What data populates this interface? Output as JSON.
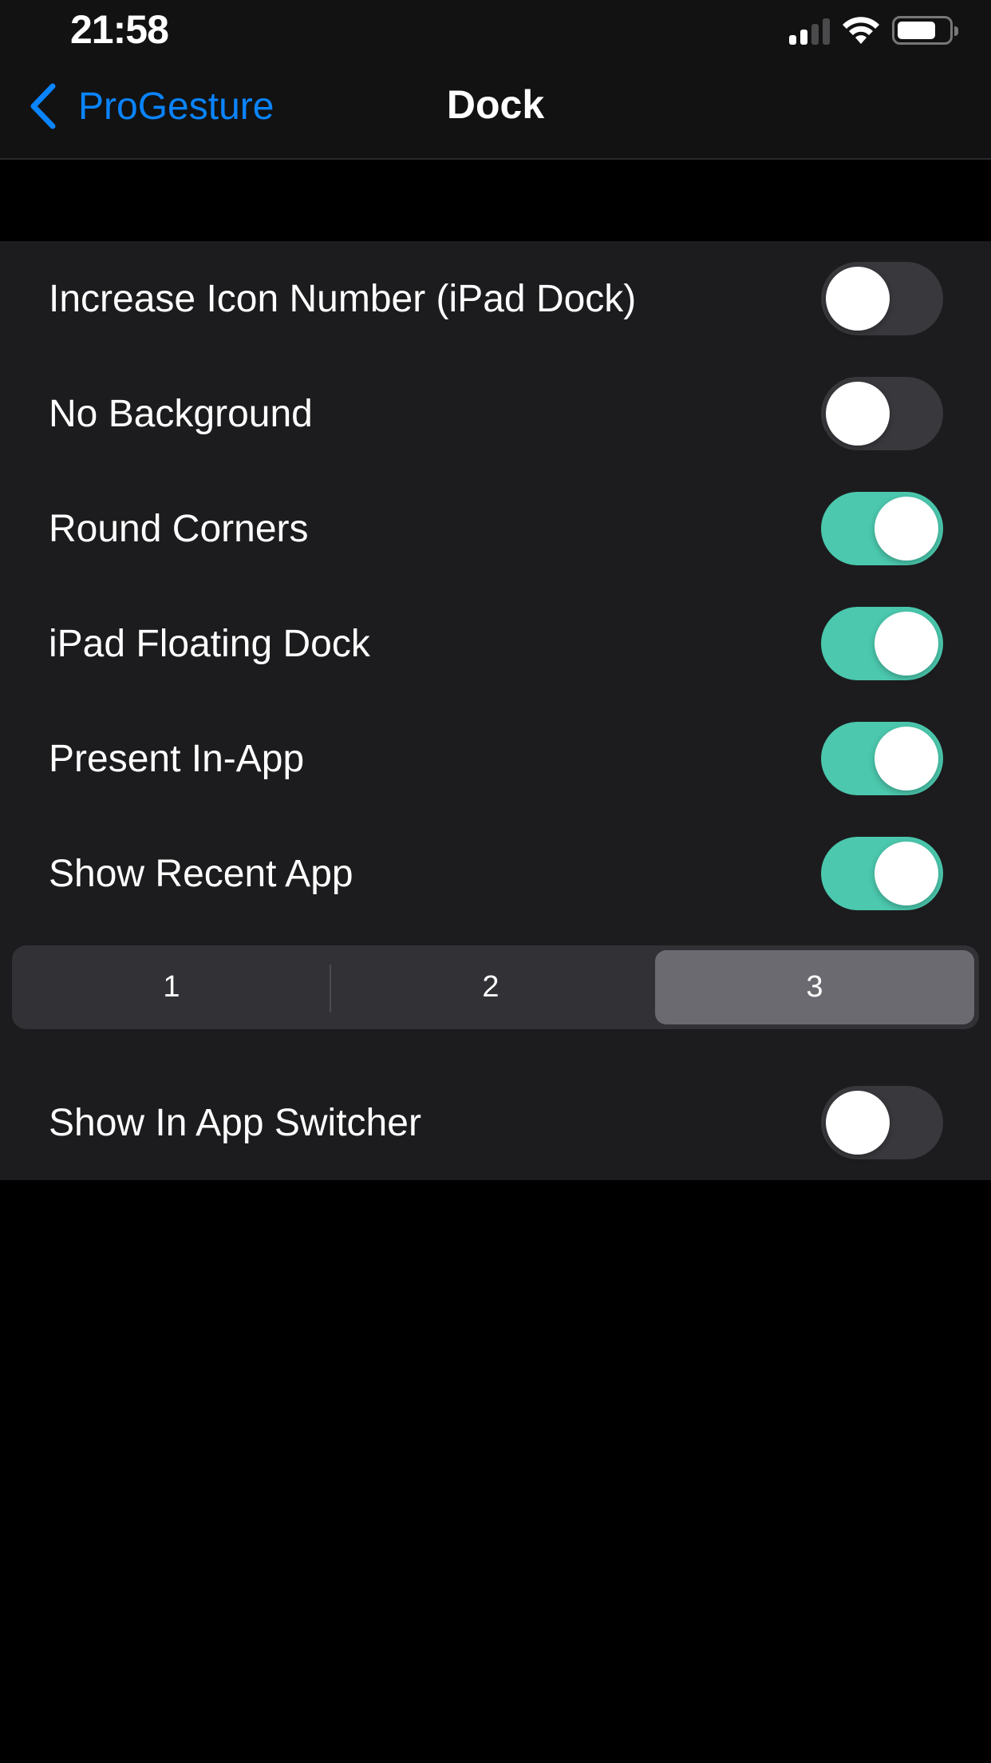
{
  "status_bar": {
    "time": "21:58",
    "signal_bars_active": 2,
    "signal_bars_total": 4,
    "battery_percent": 75,
    "icons": [
      "cellular-signal-icon",
      "wifi-icon",
      "battery-icon"
    ]
  },
  "nav": {
    "back_label": "ProGesture",
    "title": "Dock"
  },
  "colors": {
    "accent_blue": "#0a84ff",
    "toggle_on": "#4bc8ad",
    "toggle_off": "#39393d"
  },
  "settings": [
    {
      "label": "Increase Icon Number (iPad Dock)",
      "enabled": false
    },
    {
      "label": "No Background",
      "enabled": false
    },
    {
      "label": "Round Corners",
      "enabled": true
    },
    {
      "label": "iPad Floating Dock",
      "enabled": true
    },
    {
      "label": "Present In-App",
      "enabled": true
    },
    {
      "label": "Show Recent App",
      "enabled": true
    }
  ],
  "recent_app_count": {
    "options": [
      "1",
      "2",
      "3"
    ],
    "selected": "3"
  },
  "app_switcher": {
    "label": "Show In App Switcher",
    "enabled": false
  }
}
